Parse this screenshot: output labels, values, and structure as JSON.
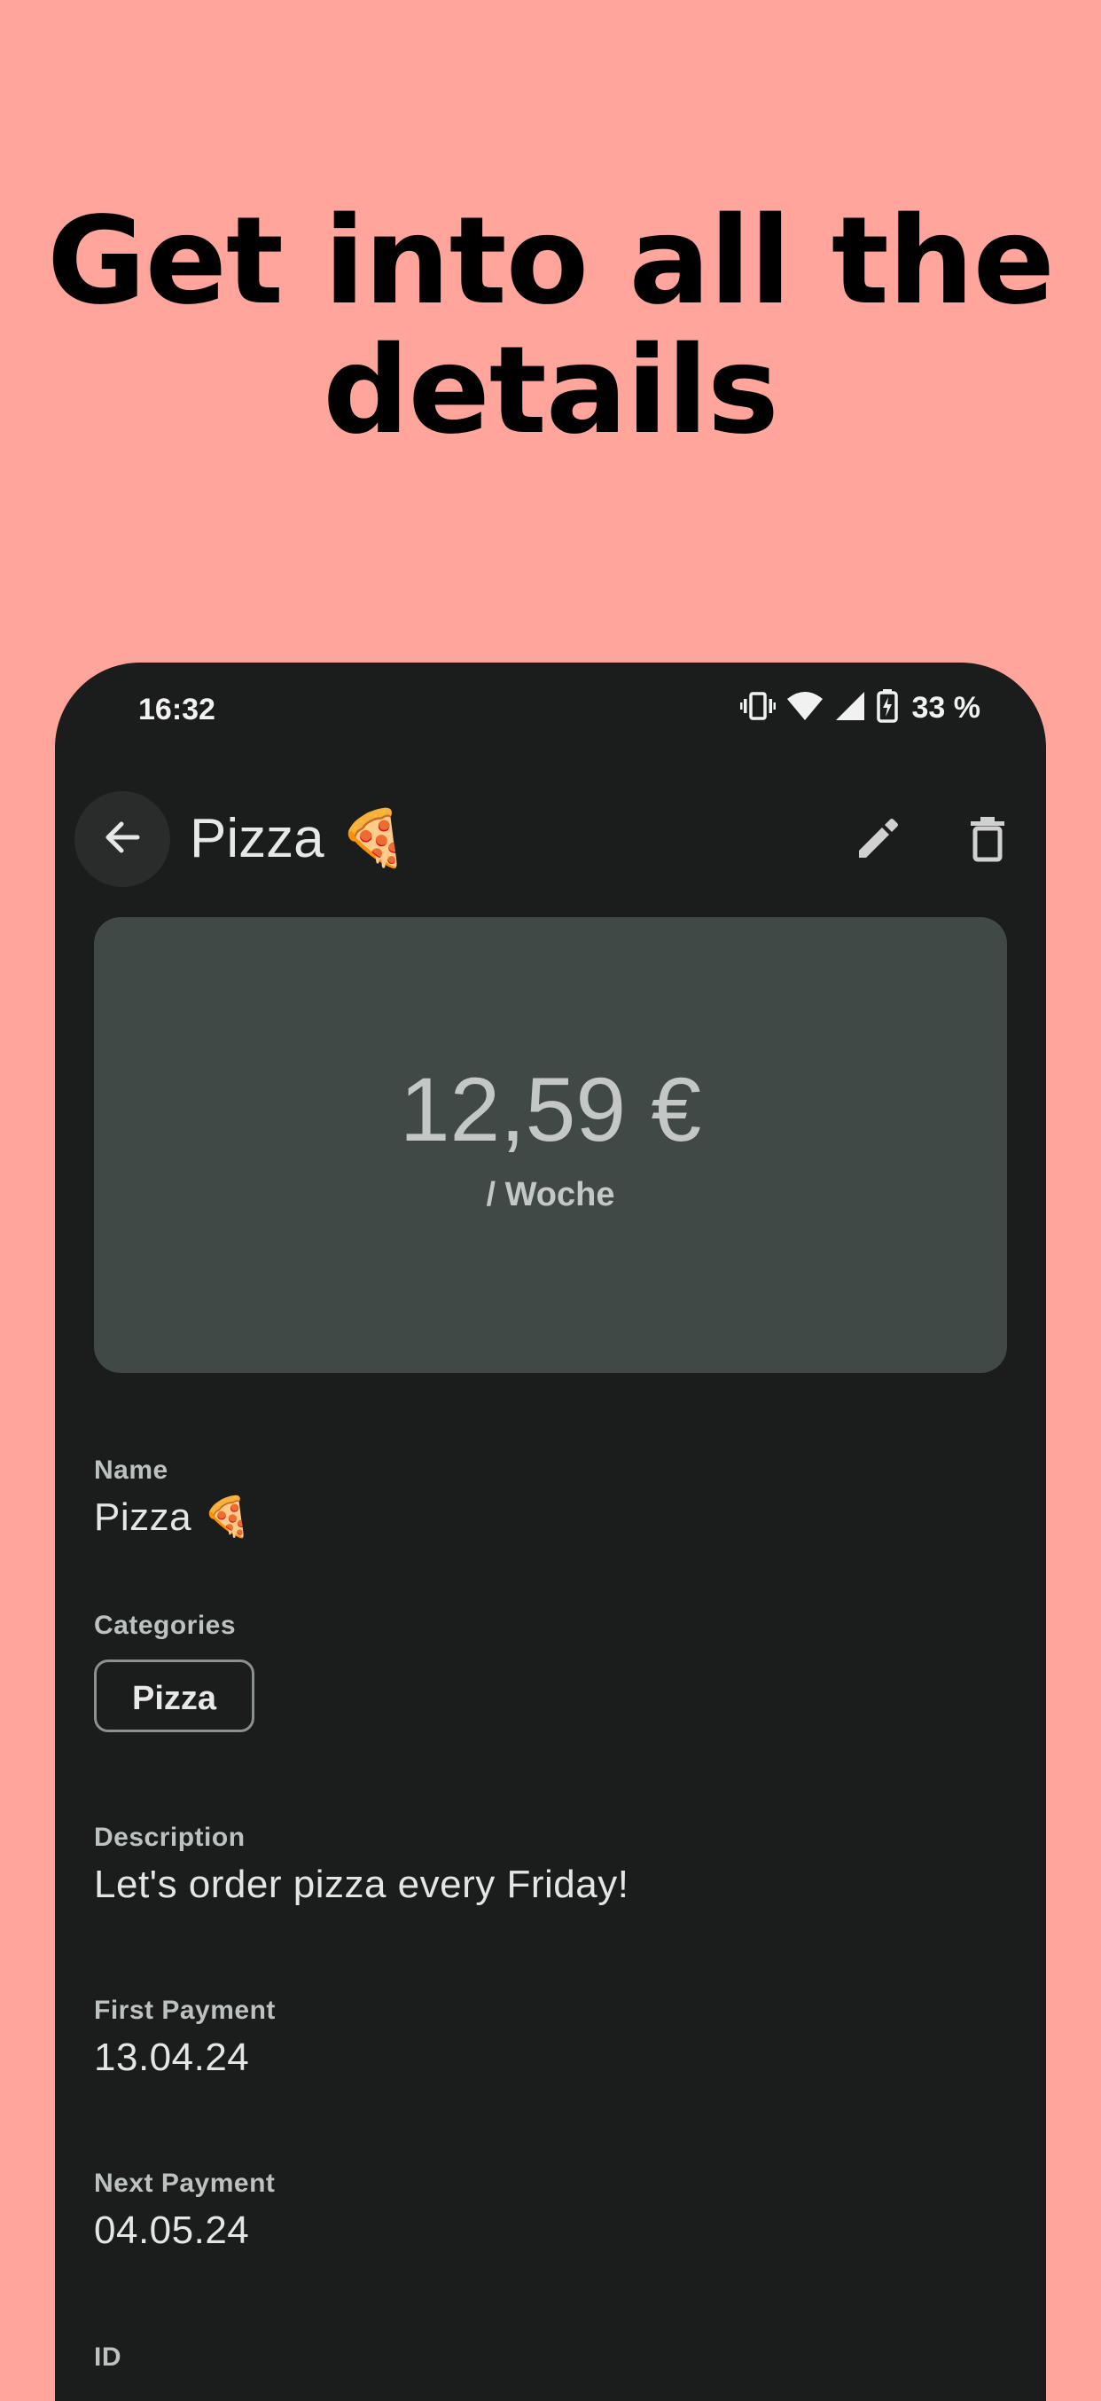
{
  "promo": {
    "headline_line1": "Get into all the",
    "headline_line2": "details"
  },
  "status_bar": {
    "time": "16:32",
    "battery": "33 %",
    "icons": [
      "vibrate-icon",
      "wifi-icon",
      "signal-icon",
      "battery-charging-icon"
    ]
  },
  "app_bar": {
    "title": "Pizza 🍕",
    "back_icon": "arrow-back-icon",
    "edit_icon": "pencil-icon",
    "delete_icon": "trash-icon"
  },
  "price_card": {
    "amount": "12,59 €",
    "period": "/ Woche"
  },
  "details": {
    "name_label": "Name",
    "name_value": "Pizza 🍕",
    "categories_label": "Categories",
    "categories": [
      "Pizza"
    ],
    "description_label": "Description",
    "description_value": "Let's order pizza every Friday!",
    "first_payment_label": "First Payment",
    "first_payment_value": "13.04.24",
    "next_payment_label": "Next Payment",
    "next_payment_value": "04.05.24",
    "id_label": "ID"
  },
  "colors": {
    "background": "#FFA59B",
    "surface": "#1B1C1C",
    "card": "#414947"
  }
}
